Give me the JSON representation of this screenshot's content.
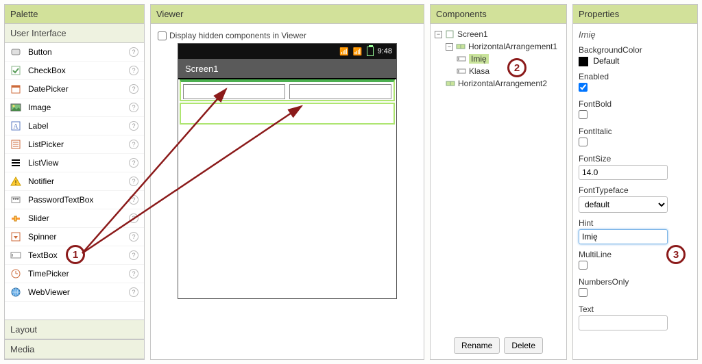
{
  "palette": {
    "header": "Palette",
    "categories": {
      "user_interface": "User Interface",
      "layout": "Layout",
      "media": "Media"
    },
    "items": [
      {
        "label": "Button"
      },
      {
        "label": "CheckBox"
      },
      {
        "label": "DatePicker"
      },
      {
        "label": "Image"
      },
      {
        "label": "Label"
      },
      {
        "label": "ListPicker"
      },
      {
        "label": "ListView"
      },
      {
        "label": "Notifier"
      },
      {
        "label": "PasswordTextBox"
      },
      {
        "label": "Slider"
      },
      {
        "label": "Spinner"
      },
      {
        "label": "TextBox"
      },
      {
        "label": "TimePicker"
      },
      {
        "label": "WebViewer"
      }
    ]
  },
  "viewer": {
    "header": "Viewer",
    "display_hidden_label": "Display hidden components in Viewer",
    "display_hidden_checked": false,
    "statusbar": {
      "time": "9:48"
    },
    "appbar_title": "Screen1"
  },
  "components": {
    "header": "Components",
    "rename": "Rename",
    "delete": "Delete",
    "tree": {
      "label": "Screen1",
      "children": [
        {
          "label": "HorizontalArrangement1",
          "children": [
            {
              "label": "Imię",
              "selected": true
            },
            {
              "label": "Klasa"
            }
          ]
        },
        {
          "label": "HorizontalArrangement2"
        }
      ]
    }
  },
  "properties": {
    "header": "Properties",
    "component_name": "Imię",
    "labels": {
      "bgcolor": "BackgroundColor",
      "bgvalue": "Default",
      "enabled": "Enabled",
      "fontbold": "FontBold",
      "fontitalic": "FontItalic",
      "fontsize": "FontSize",
      "fonttypeface": "FontTypeface",
      "hint": "Hint",
      "multiline": "MultiLine",
      "numbersonly": "NumbersOnly",
      "text": "Text"
    },
    "values": {
      "enabled": true,
      "fontbold": false,
      "fontitalic": false,
      "fontsize": "14.0",
      "fonttypeface": "default",
      "hint": "Imię",
      "multiline": false,
      "numbersonly": false,
      "text": ""
    }
  },
  "annotations": {
    "b1": "1",
    "b2": "2",
    "b3": "3"
  }
}
